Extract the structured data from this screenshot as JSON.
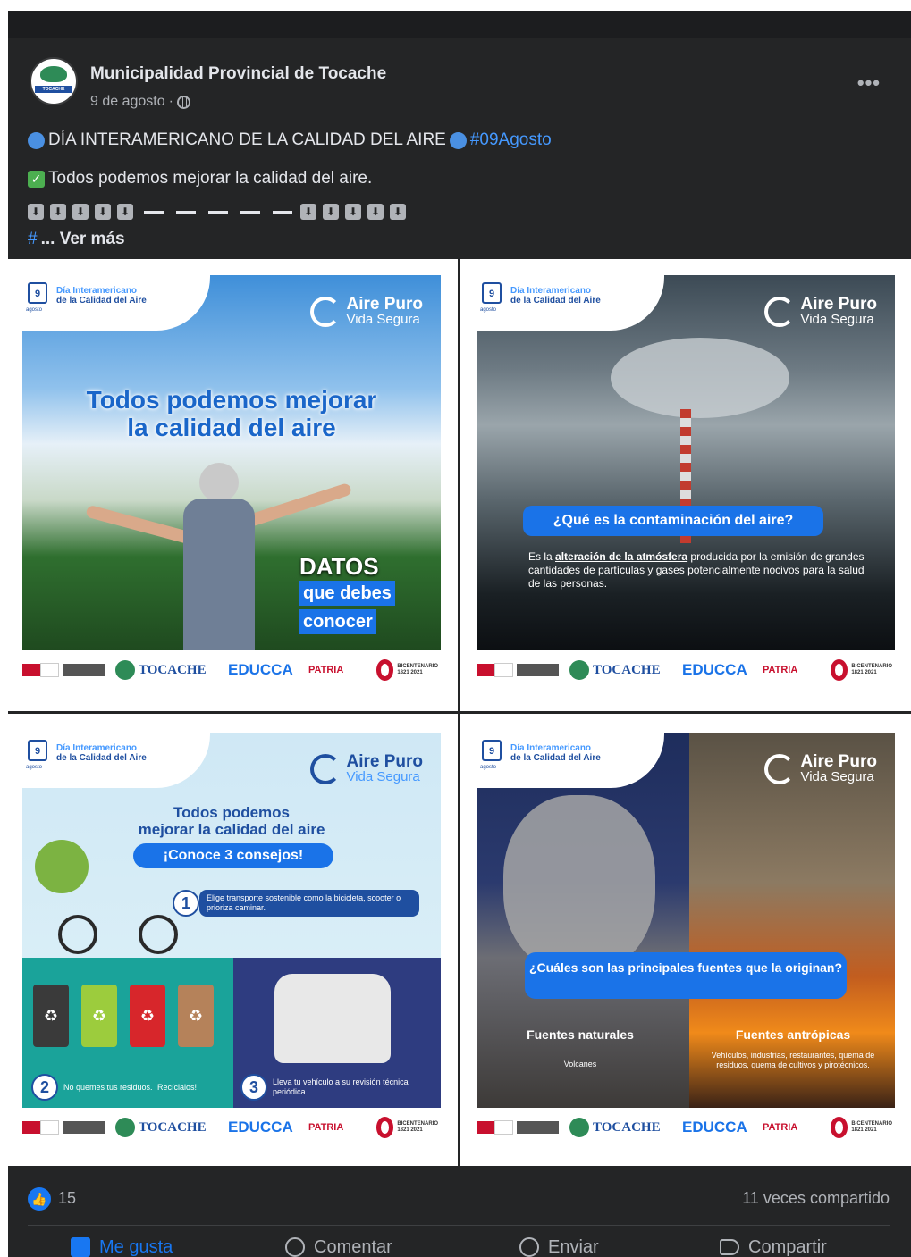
{
  "post": {
    "page_name": "Municipalidad Provincial de Tocache",
    "avatar_text": "TOCACHE",
    "date": "9 de agosto",
    "date_separator": "·",
    "more_label": "•••",
    "line1_text": "DÍA INTERAMERICANO DE LA CALIDAD DEL AIRE",
    "line1_hashtag": "#09Agosto",
    "line2_text": "Todos podemos mejorar la calidad del aire.",
    "line3_down_arrow": "⬇",
    "line4_hashtag": "#",
    "see_more": "... Ver más"
  },
  "tiles": {
    "calendar_day": "9",
    "calendar_month": "agosto",
    "dia_line1": "Día Interamericano",
    "dia_line2": "de la Calidad del Aire",
    "brand_line1": "Aire Puro",
    "brand_line2": "Vida Segura",
    "t1": {
      "headline_line1": "Todos podemos mejorar",
      "headline_line2": "la calidad del aire",
      "datos": "DATOS",
      "datos_hl1": "que debes",
      "datos_hl2": "conocer"
    },
    "t2": {
      "question": "¿Qué es la contaminación del aire?",
      "body_pre": "Es la ",
      "body_bold": "alteración de la atmósfera",
      "body_post": " producida por la emisión de grandes cantidades de partículas y gases potencialmente nocivos para la salud de las personas."
    },
    "t3": {
      "title_line1": "Todos podemos",
      "title_line2": "mejorar la calidad del aire",
      "pill": "¡Conoce 3 consejos!",
      "tip1_num": "1",
      "tip1_text": "Elige transporte sostenible como la bicicleta, scooter o prioriza caminar.",
      "tip2_num": "2",
      "tip2_text": "No quemes tus residuos. ¡Recíclalos!",
      "tip3_num": "3",
      "tip3_text": "Lleva tu vehículo a su revisión técnica periódica.",
      "recycle_icon": "♻"
    },
    "t4": {
      "question": "¿Cuáles son las principales fuentes que la originan?",
      "natural_head": "Fuentes naturales",
      "natural_sub": "Volcanes",
      "anthro_head": "Fuentes antrópicas",
      "anthro_sub": "Vehículos, industrias, restaurantes, quema de residuos, quema de cultivos y pirotécnicos."
    },
    "logos": {
      "tocache": "TOCACHE",
      "educca": "EDUCCA",
      "patria": "PATRIA",
      "bicentenario": "BICENTENARIO 1821 2021"
    }
  },
  "footer": {
    "like_count": "15",
    "shares": "11 veces compartido",
    "like_label": "Me gusta",
    "comment_label": "Comentar",
    "send_label": "Enviar",
    "share_label": "Compartir",
    "like_icon_glyph": "👍"
  },
  "colors": {
    "card_bg": "#242526",
    "text_primary": "#e4e6eb",
    "text_secondary": "#b0b3b8",
    "link": "#4599ff",
    "accent_blue": "#1877f2"
  }
}
